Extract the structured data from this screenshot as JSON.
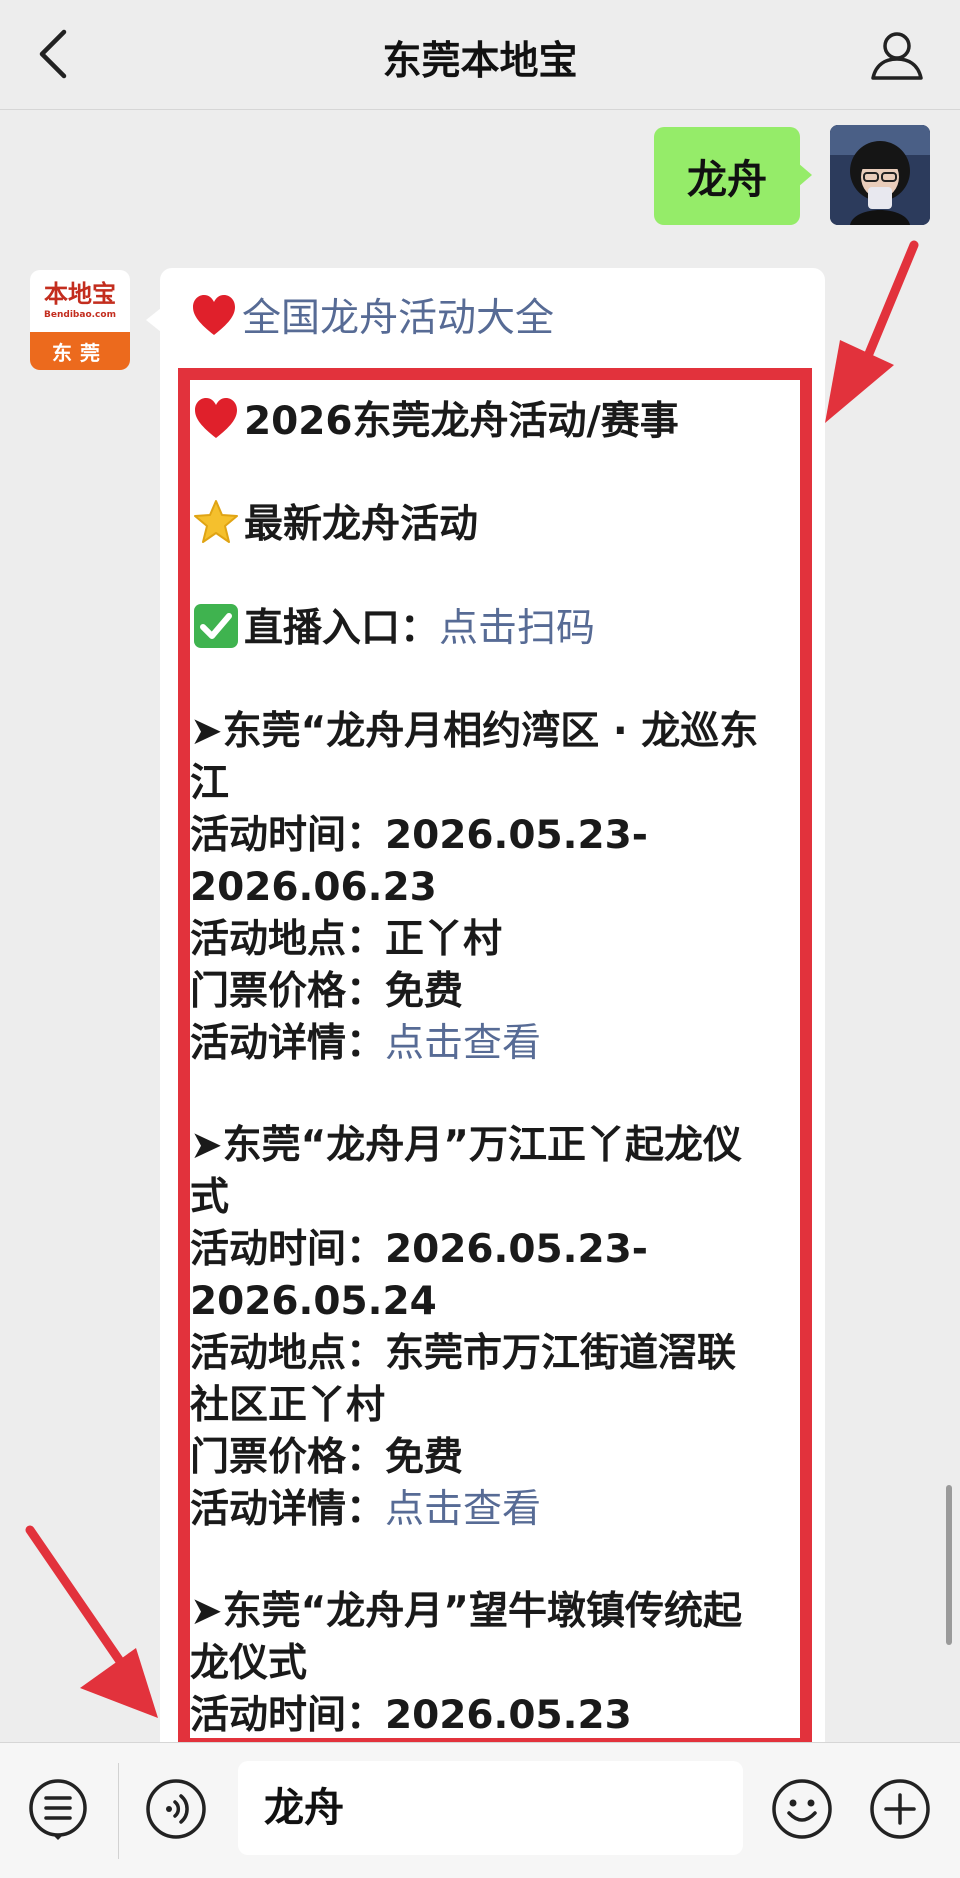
{
  "header": {
    "title": "东莞本地宝"
  },
  "user_message": {
    "text": "龙舟"
  },
  "bot_avatar": {
    "logo": "本地宝",
    "site": "Bendibao.com",
    "city": "东莞"
  },
  "bot_message": {
    "heading": "全国龙舟活动大全",
    "line_2026": "2026东莞龙舟活动/赛事",
    "line_latest": "最新龙舟活动",
    "live_label": "直播入口：",
    "live_link": "点击扫码",
    "events": [
      {
        "title_line1": "➤东莞“龙舟月相约湾区 · 龙巡东",
        "title_line2": "江",
        "time_label": "活动时间：",
        "time_line1": "2026.05.23-",
        "time_line2": "2026.06.23",
        "place_label": "活动地点：",
        "place_line1": "正丫村",
        "price_label": "门票价格：",
        "price": "免费",
        "detail_label": "活动详情：",
        "detail_link": "点击查看"
      },
      {
        "title_line1": "➤东莞“龙舟月”万江正丫起龙仪",
        "title_line2": "式",
        "time_label": "活动时间：",
        "time_line1": "2026.05.23-",
        "time_line2": "2026.05.24",
        "place_label": "活动地点：",
        "place_line1": "东莞市万江街道滘联",
        "place_line2": "社区正丫村",
        "price_label": "门票价格：",
        "price": "免费",
        "detail_label": "活动详情：",
        "detail_link": "点击查看"
      },
      {
        "title_line1": "➤东莞“龙舟月”望牛墩镇传统起",
        "title_line2": "龙仪式",
        "time_label": "活动时间：",
        "time_line1": "2026.05.23"
      }
    ]
  },
  "input_bar": {
    "value": "龙舟"
  },
  "colors": {
    "highlight": "#e2323c",
    "link": "#576b95",
    "user_bubble": "#95ec69"
  }
}
